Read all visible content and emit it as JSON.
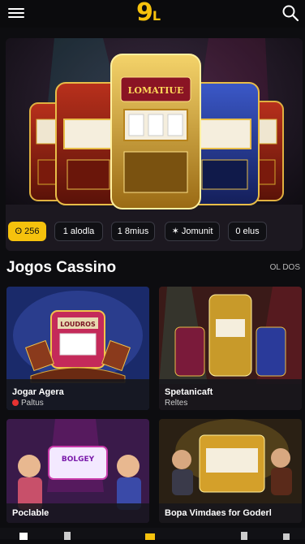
{
  "header": {
    "logo_main": "9",
    "logo_small": "L"
  },
  "hero": {
    "chips": [
      {
        "label": "ʘ 256",
        "active": true
      },
      {
        "label": "1 alodla",
        "active": false
      },
      {
        "label": "1 8mius",
        "active": false
      },
      {
        "label": "✶ Jomunit",
        "active": false
      },
      {
        "label": "0 elus",
        "active": false
      }
    ],
    "marquee": "LOMATIUE"
  },
  "section": {
    "title": "Jogos Cassino",
    "see_all": "OL DOS"
  },
  "cards": [
    {
      "title": "Jogar Agera",
      "subtitle": "Paltus",
      "sign": "LOUDROS"
    },
    {
      "title": "Spetanicaft",
      "subtitle": "Reltes"
    },
    {
      "title": "Poclable",
      "sign": "BOLGEY"
    },
    {
      "title": "Bopa Vimdaes for Goderl"
    }
  ],
  "colors": {
    "accent": "#f6c20d",
    "bg": "#0d0d10"
  }
}
